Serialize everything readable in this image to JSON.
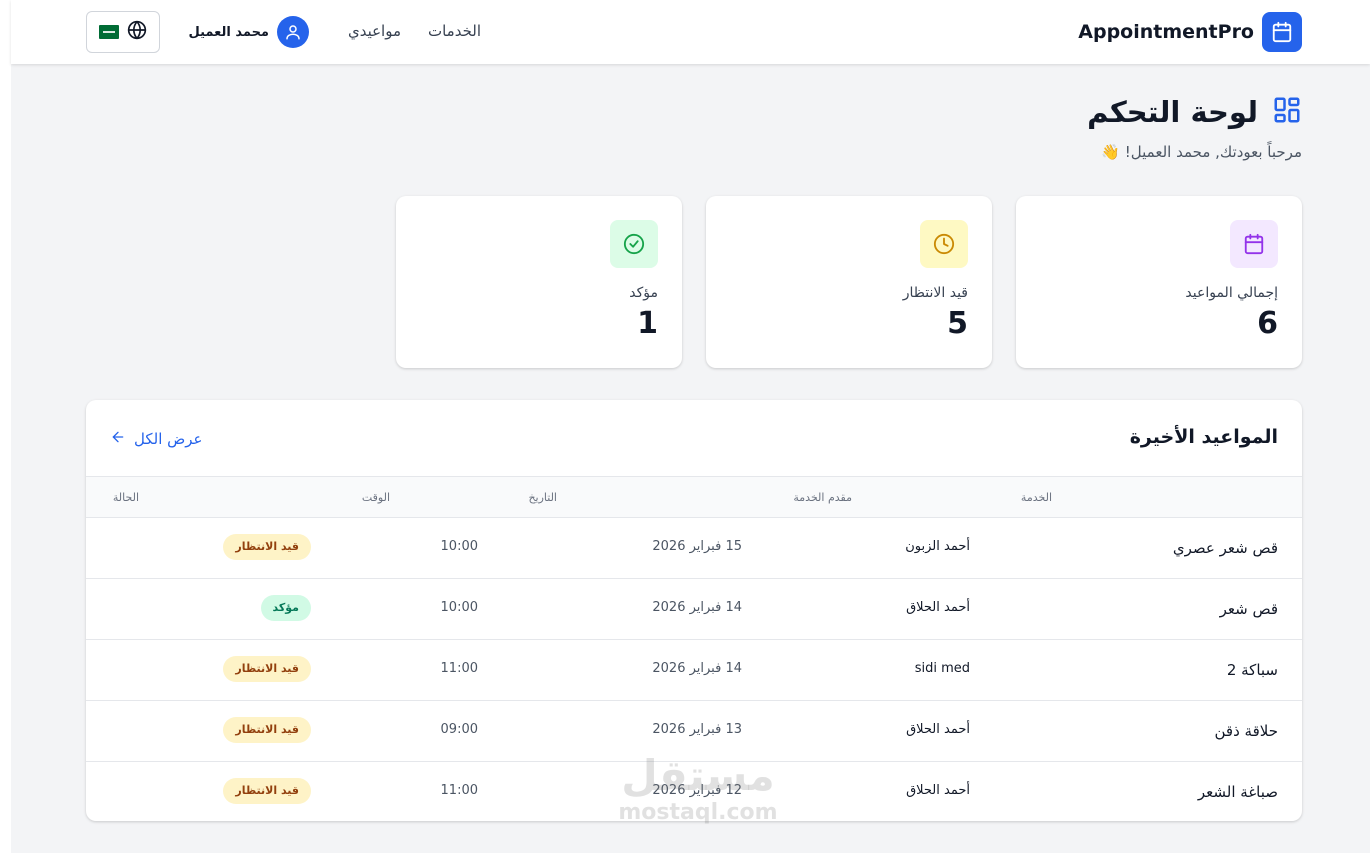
{
  "header": {
    "brand_name": "AppointmentPro",
    "nav": {
      "services": "الخدمات",
      "my_appointments": "مواعيدي"
    },
    "user_name": "محمد العميل"
  },
  "page": {
    "title": "لوحة التحكم",
    "welcome": "مرحباً بعودتك, محمد العميل! 👋"
  },
  "stats": {
    "total": {
      "label": "إجمالي المواعيد",
      "value": "6",
      "color": "#9333ea",
      "bg": "#f3e8ff",
      "icon": "calendar-icon"
    },
    "pending": {
      "label": "قيد الانتظار",
      "value": "5",
      "color": "#ca8a04",
      "bg": "#fef9c3",
      "icon": "clock-icon"
    },
    "confirmed": {
      "label": "مؤكد",
      "value": "1",
      "color": "#16a34a",
      "bg": "#dcfce7",
      "icon": "check-circle-icon"
    }
  },
  "recent": {
    "title": "المواعيد الأخيرة",
    "view_all": "عرض الكل",
    "columns": {
      "service": "الخدمة",
      "provider": "مقدم الخدمة",
      "date": "التاريخ",
      "time": "الوقت",
      "status": "الحالة"
    },
    "rows": [
      {
        "service": "قص شعر عصري",
        "provider": "أحمد الزبون",
        "date": "15 فبراير 2026",
        "time": "10:00",
        "status": "قيد الانتظار"
      },
      {
        "service": "قص شعر",
        "provider": "أحمد الحلاق",
        "date": "14 فبراير 2026",
        "time": "10:00",
        "status": "مؤكد"
      },
      {
        "service": "سباكة 2",
        "provider": "sidi med",
        "date": "14 فبراير 2026",
        "time": "11:00",
        "status": "قيد الانتظار"
      },
      {
        "service": "حلاقة ذقن",
        "provider": "أحمد الحلاق",
        "date": "13 فبراير 2026",
        "time": "09:00",
        "status": "قيد الانتظار"
      },
      {
        "service": "صباغة الشعر",
        "provider": "أحمد الحلاق",
        "date": "12 فبراير 2026",
        "time": "11:00",
        "status": "قيد الانتظار"
      }
    ]
  },
  "watermark": {
    "arabic": "مستقل",
    "latin": "mostaql.com"
  },
  "colors": {
    "accent": "#2563eb",
    "pending_badge": "#fef3c7",
    "confirmed_badge": "#d1fae5"
  }
}
